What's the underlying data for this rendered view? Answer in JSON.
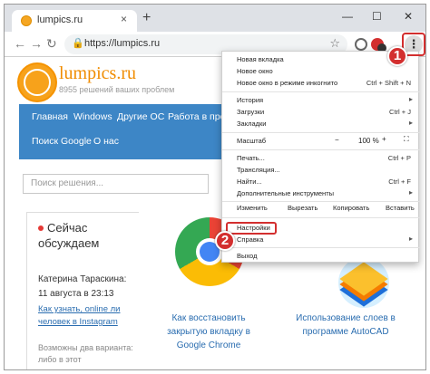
{
  "tab": {
    "title": "lumpics.ru",
    "close": "×"
  },
  "newtab": "+",
  "window_controls": {
    "minimize": "—",
    "maximize": "☐",
    "close": "✕"
  },
  "nav": {
    "back": "←",
    "forward": "→",
    "reload": "↻"
  },
  "omnibox": {
    "url": "https://lumpics.ru",
    "lock": "🔒",
    "star": "☆"
  },
  "menu_button": "⋮",
  "site": {
    "logo_text": "lumpics.ru",
    "logo_sub": "8955 решений ваших проблем",
    "nav_row1": [
      "Главная",
      "Windows",
      "Другие ОС",
      "Работа в прогр"
    ],
    "nav_row2": [
      "Поиск Google",
      "О нас"
    ],
    "search_placeholder": "Поиск решения...",
    "news": {
      "title": "Сейчас обсуждаем",
      "author": "Катерина Тараскина:",
      "date": "11 августа в 23:13",
      "link": "Как узнать, online ли человек в Instagram",
      "more": "Возможны два варианта: либо в этот"
    },
    "article1": "Как восстановить закрытую вкладку в Google Chrome",
    "article2": "Использование слоев в программе AutoCAD"
  },
  "menu": {
    "items": [
      {
        "label": "Новая вкладка",
        "shortcut": ""
      },
      {
        "label": "Новое окно",
        "shortcut": ""
      },
      {
        "label": "Новое окно в режиме инкогнито",
        "shortcut": "Ctrl + Shift + N"
      },
      {
        "label": "История",
        "shortcut": ""
      },
      {
        "label": "Загрузки",
        "shortcut": "Ctrl + J"
      },
      {
        "label": "Закладки",
        "shortcut": ""
      },
      {
        "label": "Масштаб",
        "shortcut": ""
      },
      {
        "label": "Печать...",
        "shortcut": "Ctrl + P"
      },
      {
        "label": "Трансляция...",
        "shortcut": ""
      },
      {
        "label": "Найти...",
        "shortcut": "Ctrl + F"
      },
      {
        "label": "Дополнительные инструменты",
        "shortcut": ""
      },
      {
        "label": "Настройки",
        "shortcut": ""
      },
      {
        "label": "Справка",
        "shortcut": ""
      },
      {
        "label": "Выход",
        "shortcut": ""
      }
    ],
    "zoom": {
      "minus": "−",
      "value": "100 %",
      "plus": "+",
      "fullscreen": "⛶"
    },
    "edit": {
      "label": "Изменить",
      "cut": "Вырезать",
      "copy": "Копировать",
      "paste": "Вставить"
    },
    "arrow": "▸"
  },
  "markers": {
    "one": "1",
    "two": "2"
  },
  "colors": {
    "accent_red": "#d32f2f",
    "nav_blue": "#3d86c6",
    "logo_orange": "#f08c00",
    "link_blue": "#2a6db0"
  }
}
